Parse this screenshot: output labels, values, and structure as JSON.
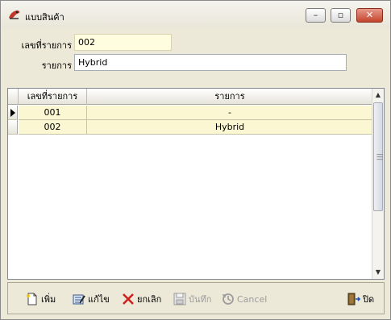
{
  "window": {
    "title": "แบบสินค้า",
    "buttons": {
      "minimize": "–",
      "maximize": "▫",
      "close": "✕"
    }
  },
  "form": {
    "code_label": "เลขที่รายการ",
    "code_value": "002",
    "name_label": "รายการ",
    "name_value": "Hybrid"
  },
  "grid": {
    "columns": [
      "เลขที่รายการ",
      "รายการ"
    ],
    "rows": [
      {
        "code": "001",
        "name": "-"
      },
      {
        "code": "002",
        "name": "Hybrid"
      }
    ]
  },
  "toolbar": {
    "add": "เพิ่ม",
    "edit": "แก้ไข",
    "delete": "ยกเลิก",
    "save": "บันทึก",
    "cancel": "Cancel",
    "close": "ปิด"
  },
  "colors": {
    "row_background": "#faf7d2",
    "code_field_background": "#fffde0",
    "delete_icon": "#d02020"
  }
}
